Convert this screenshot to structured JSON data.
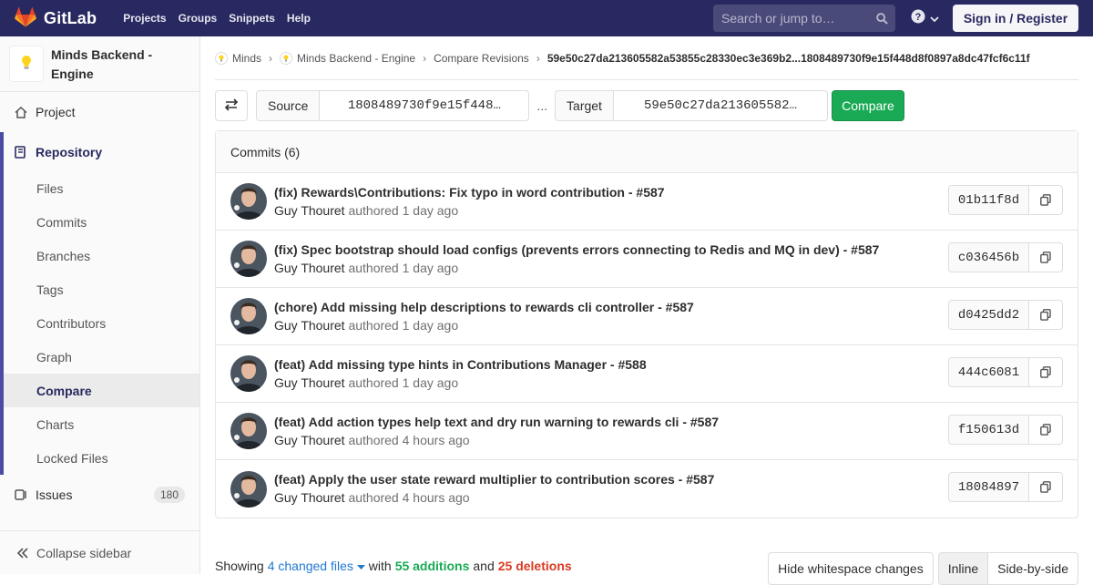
{
  "navbar": {
    "brand": "GitLab",
    "links": [
      "Projects",
      "Groups",
      "Snippets",
      "Help"
    ],
    "search_placeholder": "Search or jump to…",
    "signin": "Sign in / Register"
  },
  "sidebar": {
    "project_name": "Minds Backend - Engine",
    "project": "Project",
    "repository": "Repository",
    "repo_items": [
      "Files",
      "Commits",
      "Branches",
      "Tags",
      "Contributors",
      "Graph",
      "Compare",
      "Charts",
      "Locked Files"
    ],
    "active_item": "Compare",
    "issues": "Issues",
    "issues_count": "180",
    "collapse": "Collapse sidebar"
  },
  "breadcrumb": {
    "items": [
      "Minds",
      "Minds Backend - Engine",
      "Compare Revisions"
    ],
    "current": "59e50c27da213605582a53855c28330ec3e369b2...1808489730f9e15f448d8f0897a8dc47fcf6c11f"
  },
  "compare": {
    "source_label": "Source",
    "source_value": "1808489730f9e15f448…",
    "separator": "...",
    "target_label": "Target",
    "target_value": "59e50c27da213605582…",
    "button": "Compare"
  },
  "commits": {
    "header": "Commits (6)",
    "authored": "authored",
    "list": [
      {
        "title": "(fix) Rewards\\Contributions: Fix typo in word contribution - #587",
        "author": "Guy Thouret",
        "time": "1 day ago",
        "sha": "01b11f8d"
      },
      {
        "title": "(fix) Spec bootstrap should load configs (prevents errors connecting to Redis and MQ in dev) - #587",
        "author": "Guy Thouret",
        "time": "1 day ago",
        "sha": "c036456b"
      },
      {
        "title": "(chore) Add missing help descriptions to rewards cli controller - #587",
        "author": "Guy Thouret",
        "time": "1 day ago",
        "sha": "d0425dd2"
      },
      {
        "title": "(feat) Add missing type hints in Contributions Manager - #588",
        "author": "Guy Thouret",
        "time": "1 day ago",
        "sha": "444c6081"
      },
      {
        "title": "(feat) Add action types help text and dry run warning to rewards cli - #587",
        "author": "Guy Thouret",
        "time": "4 hours ago",
        "sha": "f150613d"
      },
      {
        "title": "(feat) Apply the user state reward multiplier to contribution scores - #587",
        "author": "Guy Thouret",
        "time": "4 hours ago",
        "sha": "18084897"
      }
    ]
  },
  "summary": {
    "showing": "Showing",
    "changed_files": "4 changed files",
    "with": "with",
    "additions": "55 additions",
    "and": "and",
    "deletions": "25 deletions",
    "hide_whitespace": "Hide whitespace changes",
    "inline": "Inline",
    "side_by_side": "Side-by-side"
  },
  "colors": {
    "navbar": "#292961",
    "accent": "#1f78d1",
    "compare_button": "#1aaa55",
    "additions": "#1aaa55",
    "deletions": "#db3b21"
  }
}
